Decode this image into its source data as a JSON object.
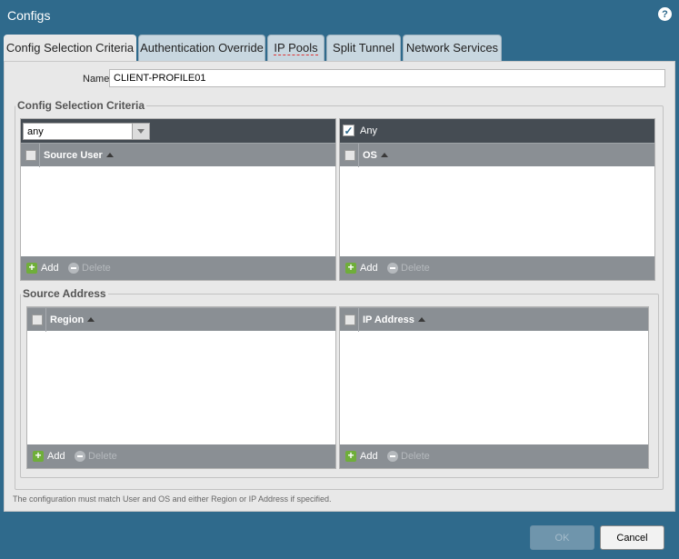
{
  "window": {
    "title": "Configs",
    "help_icon": "?"
  },
  "tabs": [
    {
      "label": "Config Selection Criteria",
      "active": true
    },
    {
      "label": "Authentication Override",
      "active": false
    },
    {
      "label": "IP Pools",
      "active": false
    },
    {
      "label": "Split Tunnel",
      "active": false
    },
    {
      "label": "Network Services",
      "active": false
    }
  ],
  "form": {
    "name_label": "Name",
    "name_value": "CLIENT-PROFILE01"
  },
  "config_selection": {
    "legend": "Config Selection Criteria",
    "user_select": {
      "value": "any"
    },
    "source_user_grid": {
      "column": "Source User",
      "add_label": "Add",
      "delete_label": "Delete"
    },
    "os_any": {
      "checked": true,
      "label": "Any"
    },
    "os_grid": {
      "column": "OS",
      "add_label": "Add",
      "delete_label": "Delete"
    },
    "source_address": {
      "legend": "Source Address",
      "region_grid": {
        "column": "Region",
        "add_label": "Add",
        "delete_label": "Delete"
      },
      "ip_grid": {
        "column": "IP Address",
        "add_label": "Add",
        "delete_label": "Delete"
      }
    }
  },
  "footnote": "The configuration must match User and OS and either Region or IP Address if specified.",
  "buttons": {
    "ok": "OK",
    "cancel": "Cancel"
  },
  "colors": {
    "titlebar": "#2f6a8c",
    "grid_header": "#8a8f94",
    "dark_bar": "#454c53",
    "add_green": "#6fae3a"
  }
}
